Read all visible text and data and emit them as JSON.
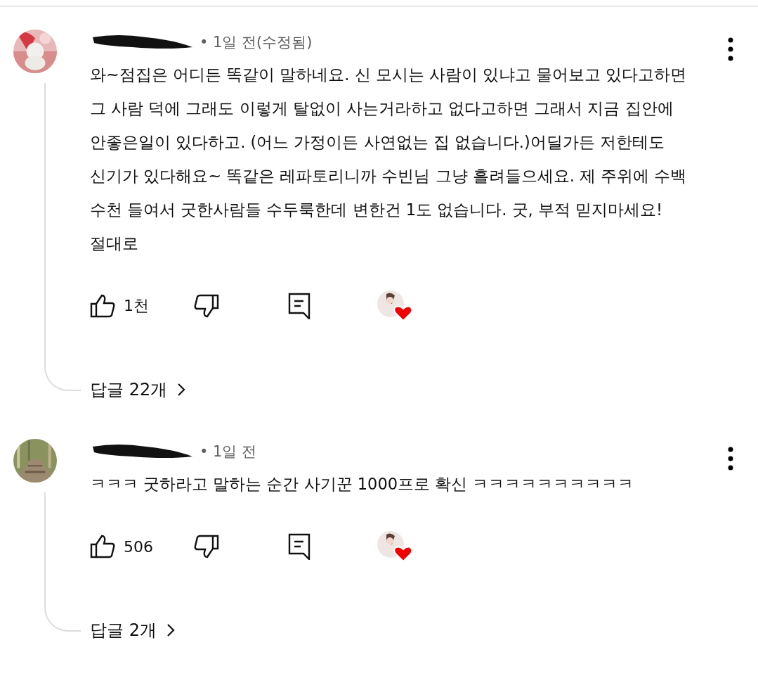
{
  "comments": [
    {
      "meta": "• 1일 전(수정됨)",
      "text": "와~점집은 어디든 똑같이 말하네요. 신 모시는 사람이 있냐고 물어보고 있다고하면 그 사람 덕에 그래도 이렇게 탈없이 사는거라하고 없다고하면 그래서 지금 집안에 안좋은일이 있다하고. (어느 가정이든 사연없는 집 없습니다.)어딜가든 저한테도 신기가 있다해요~ 똑같은 레파토리니까 수빈님 그냥 흘려들으세요. 제 주위에 수백 수천 들여서 굿한사람들 수두룩한데 변한건 1도 없습니다. 굿, 부적 믿지마세요! 절대로",
      "likes": "1천",
      "hearted": true,
      "replies": "답글 22개"
    },
    {
      "meta": "• 1일 전",
      "text": "ㅋㅋㅋ 굿하라고 말하는 순간 사기꾼 1000프로 확신 ㅋㅋㅋㅋㅋㅋㅋㅋㅋㅋ",
      "likes": "506",
      "hearted": true,
      "replies": "답글 2개"
    }
  ]
}
